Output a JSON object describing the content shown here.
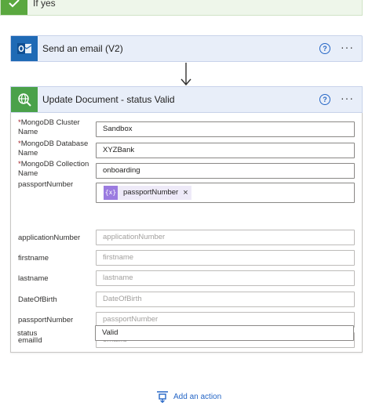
{
  "branch": {
    "label": "If yes",
    "accent": "#5aa83f"
  },
  "actions": [
    {
      "title": "Send an email (V2)",
      "help_symbol": "?",
      "more_symbol": "···",
      "accent": "#1f6ab5",
      "icon": "outlook-icon"
    },
    {
      "title": "Update Document - status Valid",
      "help_symbol": "?",
      "more_symbol": "···",
      "accent": "#4aa14a",
      "icon": "mongodb-globe-search-icon",
      "fields": [
        {
          "label": "MongoDB Cluster Name",
          "required": true,
          "value": "Sandbox",
          "placeholder": ""
        },
        {
          "label": "MongoDB Database Name",
          "required": true,
          "value": "XYZBank",
          "placeholder": ""
        },
        {
          "label": "MongoDB Collection Name",
          "required": true,
          "value": "onboarding",
          "placeholder": ""
        },
        {
          "label": "passportNumber",
          "required": false,
          "token": {
            "label": "passportNumber",
            "icon": "{x}",
            "close": "×"
          }
        },
        {
          "label": "applicationNumber",
          "required": false,
          "value": "",
          "placeholder": "applicationNumber"
        },
        {
          "label": "firstname",
          "required": false,
          "value": "",
          "placeholder": "firstname"
        },
        {
          "label": "lastname",
          "required": false,
          "value": "",
          "placeholder": "lastname"
        },
        {
          "label": "DateOfBirth",
          "required": false,
          "value": "",
          "placeholder": "DateOfBirth"
        },
        {
          "label": "passportNumber",
          "required": false,
          "value": "",
          "placeholder": "passportNumber"
        },
        {
          "label": "emailId",
          "required": false,
          "value": "",
          "placeholder": "emailId"
        },
        {
          "label": "status",
          "required": false,
          "value": "Valid",
          "placeholder": ""
        }
      ]
    }
  ],
  "add_action": {
    "label": "Add an action",
    "icon": "add-action-icon"
  }
}
